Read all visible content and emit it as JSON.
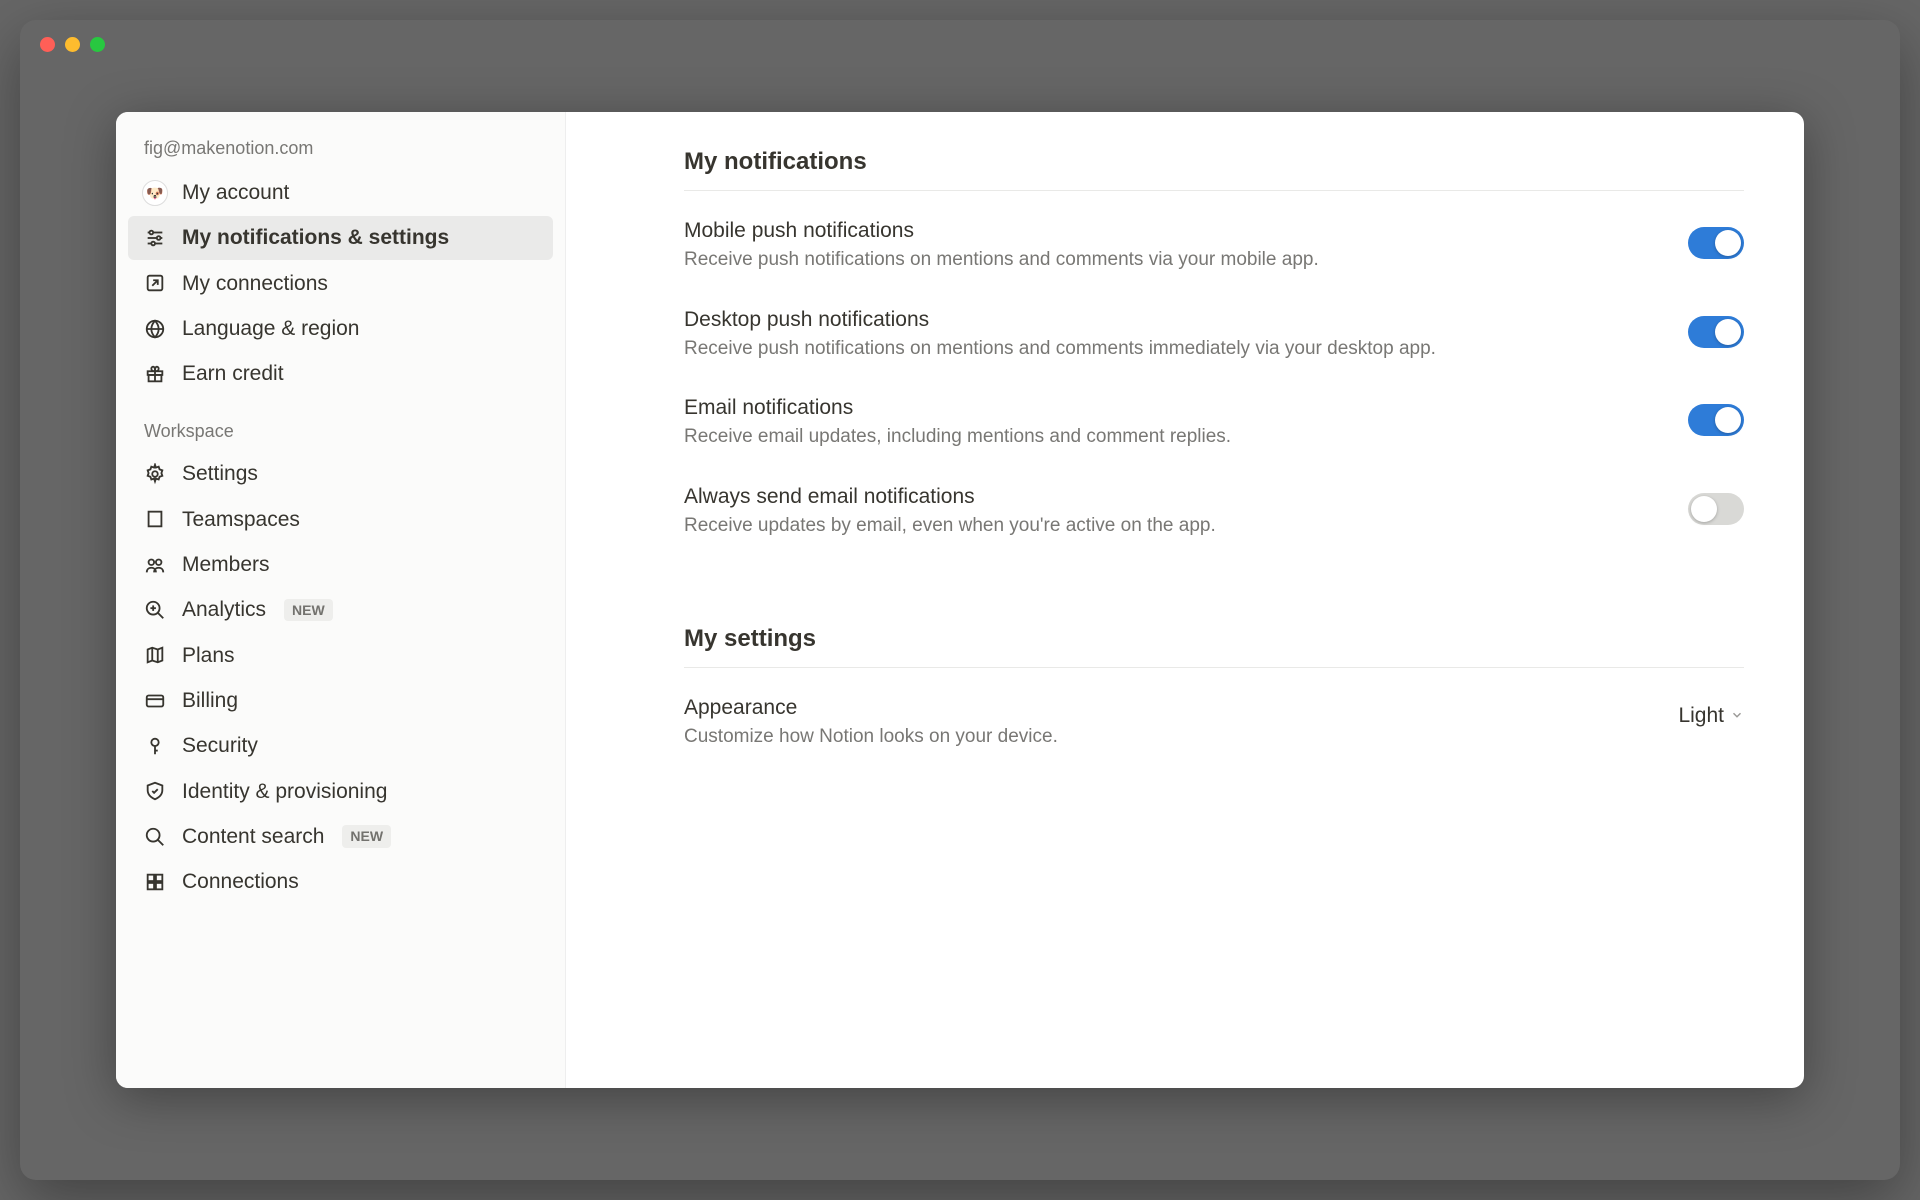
{
  "account_email": "fig@makenotion.com",
  "sidebar": {
    "account_items": [
      {
        "label": "My account"
      },
      {
        "label": "My notifications & settings"
      },
      {
        "label": "My connections"
      },
      {
        "label": "Language & region"
      },
      {
        "label": "Earn credit"
      }
    ],
    "workspace_header": "Workspace",
    "workspace_items": [
      {
        "label": "Settings"
      },
      {
        "label": "Teamspaces"
      },
      {
        "label": "Members"
      },
      {
        "label": "Analytics",
        "badge": "NEW"
      },
      {
        "label": "Plans"
      },
      {
        "label": "Billing"
      },
      {
        "label": "Security"
      },
      {
        "label": "Identity & provisioning"
      },
      {
        "label": "Content search",
        "badge": "NEW"
      },
      {
        "label": "Connections"
      }
    ]
  },
  "main": {
    "notifications": {
      "heading": "My notifications",
      "items": [
        {
          "label": "Mobile push notifications",
          "desc": "Receive push notifications on mentions and comments via your mobile app.",
          "on": true
        },
        {
          "label": "Desktop push notifications",
          "desc": "Receive push notifications on mentions and comments immediately via your desktop app.",
          "on": true
        },
        {
          "label": "Email notifications",
          "desc": "Receive email updates, including mentions and comment replies.",
          "on": true
        },
        {
          "label": "Always send email notifications",
          "desc": "Receive updates by email, even when you're active on the app.",
          "on": false
        }
      ]
    },
    "settings": {
      "heading": "My settings",
      "appearance": {
        "label": "Appearance",
        "desc": "Customize how Notion looks on your device.",
        "value": "Light"
      }
    }
  }
}
